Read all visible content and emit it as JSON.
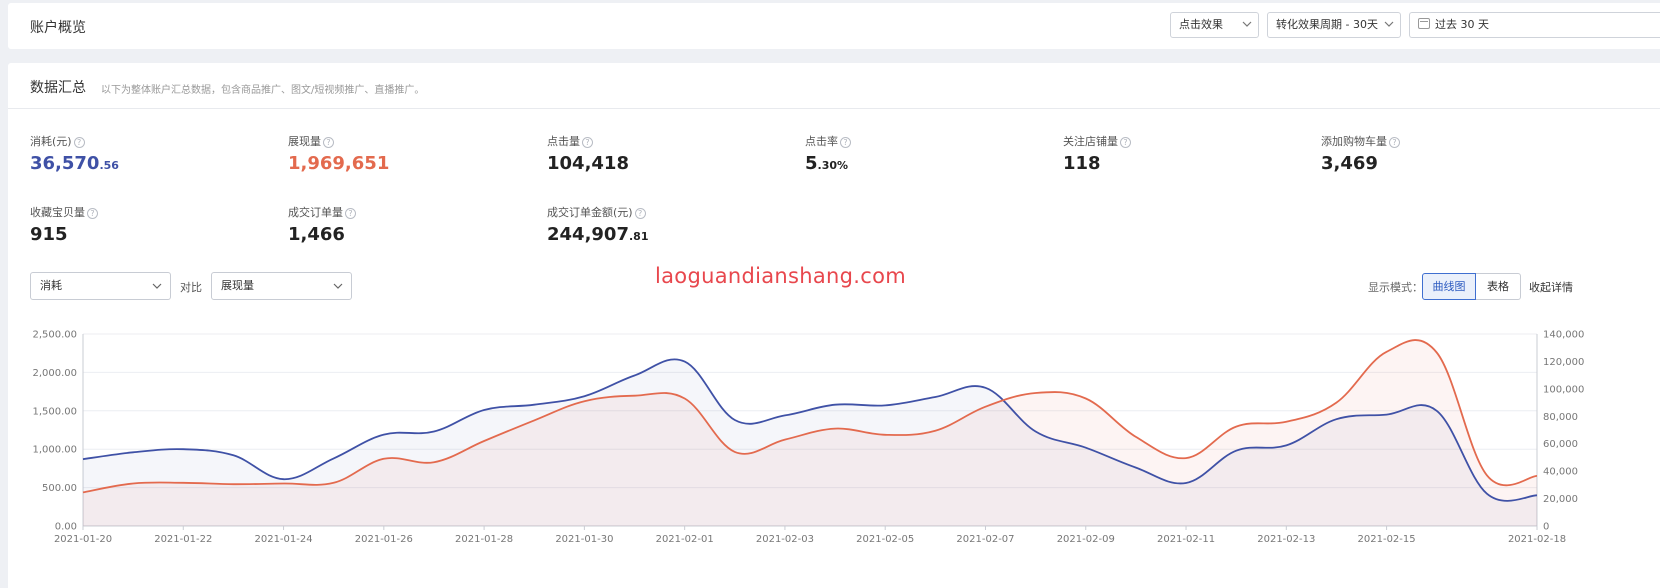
{
  "header": {
    "title": "账户概览",
    "filter_click": "点击效果",
    "filter_period": "转化效果周期 - 30天",
    "filter_range": "过去 30 天"
  },
  "summary": {
    "title": "数据汇总",
    "desc": "以下为整体账户汇总数据，包含商品推广、图文/短视频推广、直播推广。",
    "metrics": [
      {
        "label": "消耗(元)",
        "int": "36,570",
        "dec": ".56"
      },
      {
        "label": "展现量",
        "int": "1,969,651",
        "dec": ""
      },
      {
        "label": "点击量",
        "int": "104,418",
        "dec": ""
      },
      {
        "label": "点击率",
        "int": "5",
        "dec": ".30%"
      },
      {
        "label": "关注店铺量",
        "int": "118",
        "dec": ""
      },
      {
        "label": "添加购物车量",
        "int": "3,469",
        "dec": ""
      },
      {
        "label": "收藏宝贝量",
        "int": "915",
        "dec": ""
      },
      {
        "label": "成交订单量",
        "int": "1,466",
        "dec": ""
      },
      {
        "label": "成交订单金额(元)",
        "int": "244,907",
        "dec": ".81"
      }
    ]
  },
  "controls": {
    "metric_a": "消耗",
    "compare_label": "对比",
    "metric_b": "展现量",
    "watermark": "laoguandianshang.com",
    "mode_label": "显示模式：",
    "mode_curve": "曲线图",
    "mode_table": "表格",
    "collapse": "收起详情"
  },
  "colors": {
    "blue": "#3f51a6",
    "red": "#e36a4e"
  },
  "chart_data": {
    "type": "area",
    "x": [
      "2021-01-20",
      "2021-01-21",
      "2021-01-22",
      "2021-01-23",
      "2021-01-24",
      "2021-01-25",
      "2021-01-26",
      "2021-01-27",
      "2021-01-28",
      "2021-01-29",
      "2021-01-30",
      "2021-01-31",
      "2021-02-01",
      "2021-02-02",
      "2021-02-03",
      "2021-02-04",
      "2021-02-05",
      "2021-02-06",
      "2021-02-07",
      "2021-02-08",
      "2021-02-09",
      "2021-02-10",
      "2021-02-11",
      "2021-02-12",
      "2021-02-13",
      "2021-02-14",
      "2021-02-15",
      "2021-02-16",
      "2021-02-17",
      "2021-02-18"
    ],
    "x_ticks": [
      "2021-01-20",
      "2021-01-22",
      "2021-01-24",
      "2021-01-26",
      "2021-01-28",
      "2021-01-30",
      "2021-02-01",
      "2021-02-03",
      "2021-02-05",
      "2021-02-07",
      "2021-02-09",
      "2021-02-11",
      "2021-02-13",
      "2021-02-15",
      "2021-02-18"
    ],
    "y_left_ticks": [
      "0.00",
      "500.00",
      "1,000.00",
      "1,500.00",
      "2,000.00",
      "2,500.00"
    ],
    "y_right_ticks": [
      "0",
      "20,000",
      "40,000",
      "60,000",
      "80,000",
      "100,000",
      "120,000",
      "140,000"
    ],
    "y_left_range": [
      0,
      2500
    ],
    "y_right_range": [
      0,
      140000
    ],
    "grid": true,
    "series": [
      {
        "name": "消耗",
        "axis": "left",
        "color": "#3f51a6",
        "values": [
          870,
          960,
          1000,
          920,
          610,
          880,
          1190,
          1230,
          1510,
          1580,
          1690,
          1960,
          2140,
          1380,
          1440,
          1580,
          1570,
          1680,
          1800,
          1230,
          1020,
          760,
          560,
          980,
          1050,
          1390,
          1450,
          1500,
          420,
          400
        ]
      },
      {
        "name": "展现量",
        "axis": "right",
        "color": "#e36a4e",
        "values": [
          24500,
          31000,
          31500,
          30500,
          31000,
          31500,
          49000,
          46500,
          62000,
          77000,
          91000,
          95000,
          93000,
          54000,
          63000,
          71000,
          66500,
          69500,
          87000,
          97000,
          93000,
          65000,
          49500,
          72500,
          76000,
          90000,
          127000,
          126500,
          37000,
          36500
        ]
      }
    ]
  }
}
